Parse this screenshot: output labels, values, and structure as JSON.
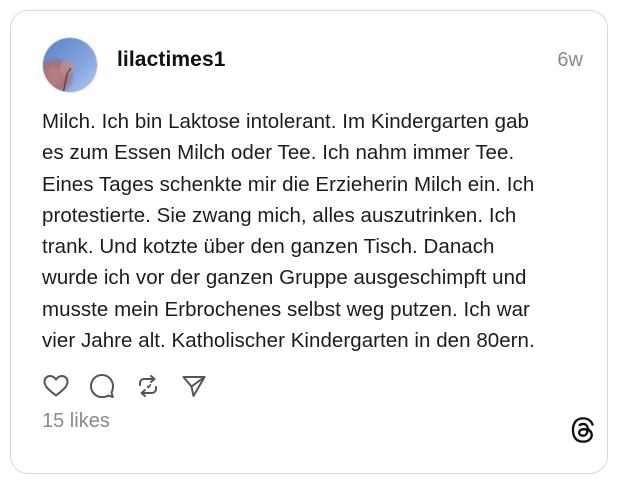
{
  "post": {
    "username": "lilactimes1",
    "timestamp": "6w",
    "text": "Milch. Ich bin Laktose intolerant. Im Kindergarten gab\nes zum Essen Milch oder Tee. Ich nahm immer Tee.\nEines Tages schenkte mir die Erzieherin Milch ein. Ich\nprotestierte. Sie zwang mich, alles auszutrinken. Ich\ntrank. Und kotzte über den ganzen Tisch. Danach\nwurde ich vor der ganzen Gruppe ausgeschimpft und\nmusste mein Erbrochenes selbst weg putzen. Ich war\nvier Jahre alt. Katholischer Kindergarten in den 80ern.",
    "likes": "15 likes"
  },
  "actions": {
    "like_icon": "heart-icon",
    "comment_icon": "comment-icon",
    "repost_icon": "repost-icon",
    "share_icon": "send-icon"
  },
  "branding": {
    "logo_icon": "threads-logo-icon"
  },
  "colors": {
    "border": "#d9d9d9",
    "muted_text": "#8a8a8a",
    "text": "#1c1c1c",
    "icon": "#555555"
  }
}
